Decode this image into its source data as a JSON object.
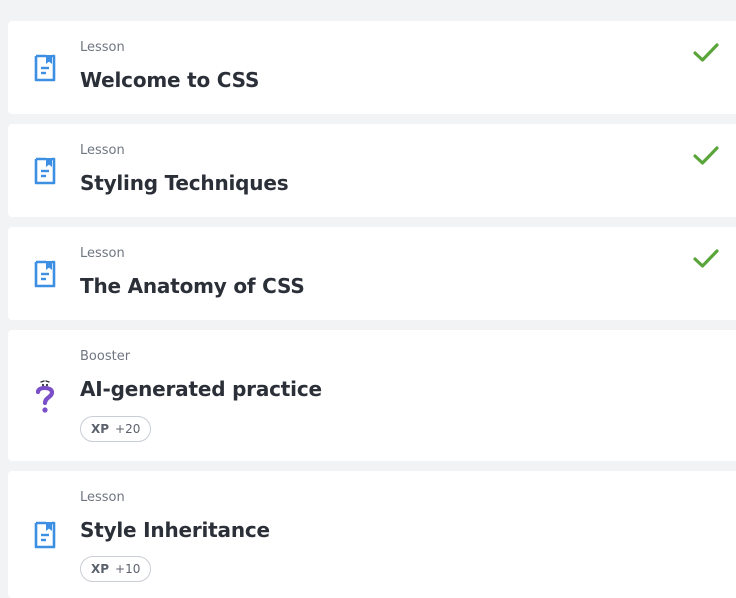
{
  "items": [
    {
      "type": "Lesson",
      "title": "Welcome to CSS",
      "completed": true,
      "icon": "lesson-icon"
    },
    {
      "type": "Lesson",
      "title": "Styling Techniques",
      "completed": true,
      "icon": "lesson-icon"
    },
    {
      "type": "Lesson",
      "title": "The Anatomy of CSS",
      "completed": true,
      "icon": "lesson-icon"
    },
    {
      "type": "Booster",
      "title": "AI-generated practice",
      "completed": false,
      "icon": "question-mark-icon",
      "xp_label": "XP",
      "xp_value": "+20"
    },
    {
      "type": "Lesson",
      "title": "Style Inheritance",
      "completed": false,
      "icon": "lesson-icon",
      "xp_label": "XP",
      "xp_value": "+10"
    }
  ],
  "colors": {
    "accent_blue": "#3d8fe3",
    "check_green": "#5aa53a",
    "booster_purple": "#7b4fc7"
  }
}
